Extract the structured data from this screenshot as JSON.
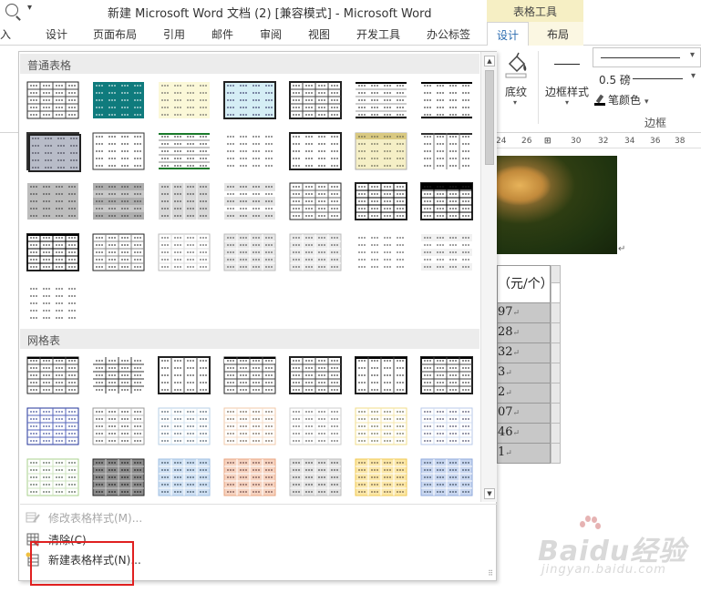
{
  "window": {
    "title": "新建 Microsoft Word 文档 (2) [兼容模式] - Microsoft Word",
    "context_group": "表格工具"
  },
  "tabs": [
    {
      "label": "插入",
      "display": "插入"
    },
    {
      "label": "设计"
    },
    {
      "label": "页面布局"
    },
    {
      "label": "引用"
    },
    {
      "label": "邮件"
    },
    {
      "label": "审阅"
    },
    {
      "label": "视图"
    },
    {
      "label": "开发工具"
    },
    {
      "label": "办公标签"
    },
    {
      "label": "设计"
    },
    {
      "label": "布局"
    }
  ],
  "ribbon": {
    "shading_label": "底纹",
    "border_style_label": "边框样式",
    "line_weight": "0.5 磅",
    "pen_color_label": "笔颜色",
    "group_label": "边框"
  },
  "ruler": [
    "24",
    "26",
    "30",
    "32",
    "34",
    "36",
    "38"
  ],
  "gallery": {
    "section_plain": "普通表格",
    "section_grid": "网格表",
    "scroll_up": "▲",
    "scroll_down": "▼"
  },
  "menu": {
    "modify": "修改表格样式(M)...",
    "clear": "清除(C)",
    "new": "新建表格样式(N)..."
  },
  "document": {
    "header_cell": "（元/个）",
    "cells": [
      "97",
      "28",
      "32",
      "3",
      "2",
      "07",
      "46",
      "1"
    ]
  },
  "watermark": {
    "line1": "Baidu经验",
    "line2": "jingyan.baidu.com"
  },
  "colors": {
    "accent": "#2b6cb0",
    "context_tab": "#f6efc4",
    "teal": "#0f7b7d",
    "highlight_box": "#e02020"
  }
}
